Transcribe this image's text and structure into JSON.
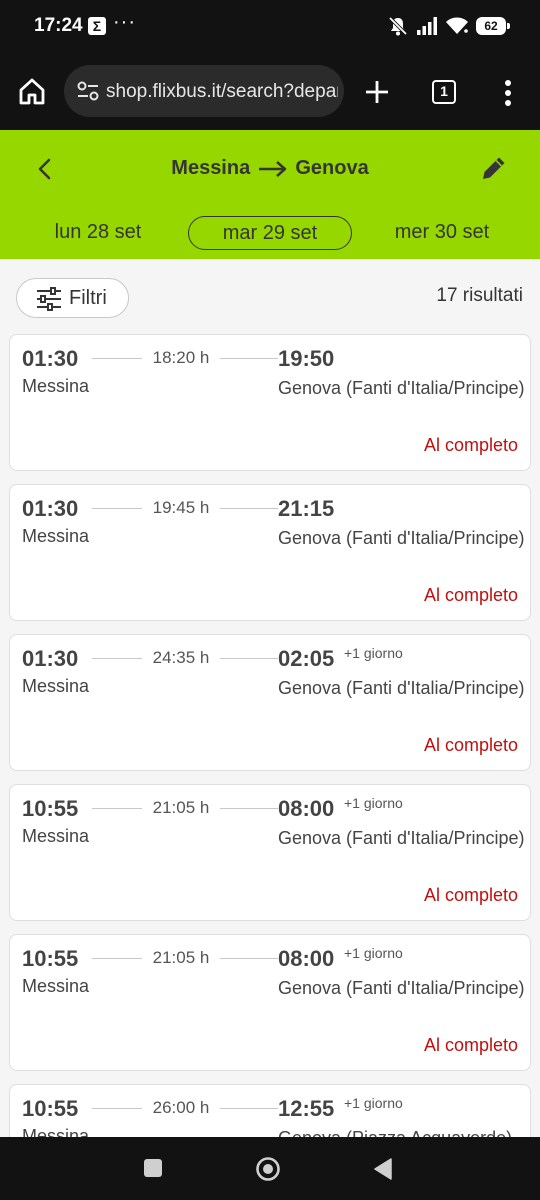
{
  "status_bar": {
    "time": "17:24",
    "sigma": "Σ",
    "dots": "···",
    "battery": "62"
  },
  "browser": {
    "url": "shop.flixbus.it/search?departureCity",
    "tab_count": "1"
  },
  "header": {
    "from": "Messina",
    "to": "Genova",
    "dates": {
      "prev": "lun 28 set",
      "current": "mar 29 set",
      "next": "mer 30 set"
    }
  },
  "filters": {
    "label": "Filtri",
    "results_count": "17 risultati"
  },
  "results": [
    {
      "dep_time": "01:30",
      "dep_city": "Messina",
      "duration": "18:20 h",
      "arr_time": "19:50",
      "day_offset": "",
      "arr_city": "Genova (Fanti d'Italia/Principe)",
      "status": "Al completo"
    },
    {
      "dep_time": "01:30",
      "dep_city": "Messina",
      "duration": "19:45 h",
      "arr_time": "21:15",
      "day_offset": "",
      "arr_city": "Genova (Fanti d'Italia/Principe)",
      "status": "Al completo"
    },
    {
      "dep_time": "01:30",
      "dep_city": "Messina",
      "duration": "24:35 h",
      "arr_time": "02:05",
      "day_offset": "+1 giorno",
      "arr_city": "Genova (Fanti d'Italia/Principe)",
      "status": "Al completo"
    },
    {
      "dep_time": "10:55",
      "dep_city": "Messina",
      "duration": "21:05 h",
      "arr_time": "08:00",
      "day_offset": "+1 giorno",
      "arr_city": "Genova (Fanti d'Italia/Principe)",
      "status": "Al completo"
    },
    {
      "dep_time": "10:55",
      "dep_city": "Messina",
      "duration": "21:05 h",
      "arr_time": "08:00",
      "day_offset": "+1 giorno",
      "arr_city": "Genova (Fanti d'Italia/Principe)",
      "status": "Al completo"
    },
    {
      "dep_time": "10:55",
      "dep_city": "Messina",
      "duration": "26:00 h",
      "arr_time": "12:55",
      "day_offset": "+1 giorno",
      "arr_city": "Genova (Piazza Acquaverde)",
      "status": ""
    }
  ],
  "colors": {
    "brand_green": "#97d700",
    "sold_out_red": "#c00f0f",
    "system_bar": "#121212"
  },
  "icons": {
    "status_bar": [
      "sigma-icon",
      "mute-icon",
      "signal-icon",
      "wifi-icon",
      "battery-icon"
    ],
    "browser": [
      "home-icon",
      "site-settings-icon",
      "new-tab-icon",
      "tab-switcher-icon",
      "more-menu-icon"
    ],
    "header": [
      "back-arrow-icon",
      "route-arrow-icon",
      "edit-pencil-icon"
    ],
    "filters": "sliders-icon",
    "nav": [
      "recents-icon",
      "home-circle-icon",
      "back-triangle-icon"
    ]
  }
}
